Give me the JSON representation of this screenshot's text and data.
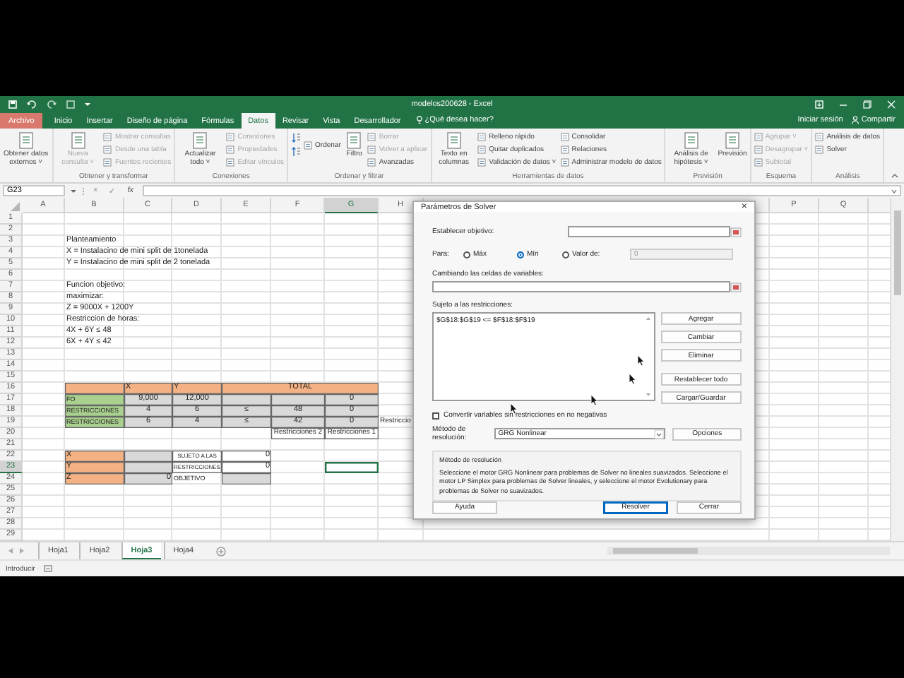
{
  "window": {
    "title": "modelos200628 - Excel"
  },
  "ribbon_tabs": [
    {
      "label": "Archivo",
      "kind": "file",
      "selected": false
    },
    {
      "label": "Inicio",
      "kind": "tab",
      "selected": false
    },
    {
      "label": "Insertar",
      "kind": "tab",
      "selected": false
    },
    {
      "label": "Diseño de página",
      "kind": "tab",
      "selected": false
    },
    {
      "label": "Fórmulas",
      "kind": "tab",
      "selected": false
    },
    {
      "label": "Datos",
      "kind": "tab",
      "selected": true
    },
    {
      "label": "Revisar",
      "kind": "tab",
      "selected": false
    },
    {
      "label": "Vista",
      "kind": "tab",
      "selected": false
    },
    {
      "label": "Desarrollador",
      "kind": "tab",
      "selected": false
    }
  ],
  "tell_me": "¿Qué desea hacer?",
  "account": {
    "sign_in": "Iniciar sesión",
    "share": "Compartir"
  },
  "ribbon": {
    "groups": [
      {
        "columns": [
          {
            "kind": "large",
            "label": "Obtener datos externos ˅",
            "disabled": false
          }
        ]
      },
      {
        "label": "Obtener y transformar",
        "columns": [
          {
            "kind": "large",
            "label": "Nueva consulta ˅",
            "disabled": true
          },
          {
            "kind": "small",
            "items": [
              {
                "label": "Mostrar consultas",
                "disabled": true
              },
              {
                "label": "Desde una tabla",
                "disabled": true
              },
              {
                "label": "Fuentes recientes",
                "disabled": true
              }
            ]
          }
        ]
      },
      {
        "label": "Conexiones",
        "columns": [
          {
            "kind": "large",
            "label": "Actualizar todo ˅",
            "disabled": false
          },
          {
            "kind": "small",
            "items": [
              {
                "label": "Conexiones",
                "disabled": true
              },
              {
                "label": "Propiedades",
                "disabled": true
              },
              {
                "label": "Editar vínculos",
                "disabled": true
              }
            ]
          }
        ]
      },
      {
        "label": "Ordenar y filtrar",
        "columns": [
          {
            "kind": "sort",
            "label": "Ordenar",
            "disabled": false
          },
          {
            "kind": "large",
            "label": "Filtro",
            "disabled": false
          },
          {
            "kind": "small",
            "items": [
              {
                "label": "Borrar",
                "disabled": true
              },
              {
                "label": "Volver a aplicar",
                "disabled": true
              },
              {
                "label": "Avanzadas",
                "disabled": false
              }
            ]
          }
        ]
      },
      {
        "label": "Herramientas de datos",
        "columns": [
          {
            "kind": "large",
            "label": "Texto en columnas",
            "disabled": false
          },
          {
            "kind": "small",
            "items": [
              {
                "label": "Relleno rápido",
                "disabled": false
              },
              {
                "label": "Quitar duplicados",
                "disabled": false
              },
              {
                "label": "Validación de datos ˅",
                "disabled": false
              }
            ]
          },
          {
            "kind": "small",
            "items": [
              {
                "label": "Consolidar",
                "disabled": false
              },
              {
                "label": "Relaciones",
                "disabled": false
              },
              {
                "label": "Administrar modelo de datos",
                "disabled": false
              }
            ]
          }
        ]
      },
      {
        "label": "Previsión",
        "columns": [
          {
            "kind": "large",
            "label": "Análisis de hipótesis ˅",
            "disabled": false
          },
          {
            "kind": "large",
            "label": "Previsión",
            "disabled": false
          }
        ]
      },
      {
        "label": "Esquema",
        "columns": [
          {
            "kind": "small",
            "items": [
              {
                "label": "Agrupar ˅",
                "disabled": true
              },
              {
                "label": "Desagrupar ˅",
                "disabled": true
              },
              {
                "label": "Subtotal",
                "disabled": true
              }
            ]
          }
        ]
      },
      {
        "label": "Análisis",
        "columns": [
          {
            "kind": "small",
            "items": [
              {
                "label": "Análisis de datos",
                "disabled": false
              },
              {
                "label": "Solver",
                "disabled": false
              }
            ]
          }
        ]
      }
    ]
  },
  "formula_bar": {
    "name_box": "G23",
    "buttons": [
      "×",
      "✓",
      "fx"
    ]
  },
  "sheet": {
    "columns": [
      "A",
      "B",
      "C",
      "D",
      "E",
      "F",
      "G",
      "H",
      "P",
      "Q"
    ],
    "rows": [
      {
        "number": "1"
      },
      {
        "number": "2"
      },
      {
        "number": "3",
        "cells": [
          null,
          {
            "kind": "text",
            "text": "Planteamiento",
            "selected": false
          }
        ]
      },
      {
        "number": "4",
        "cells": [
          null,
          {
            "kind": "text",
            "text": "X = Instalacino de mini split de 1tonelada",
            "selected": false
          }
        ]
      },
      {
        "number": "5",
        "cells": [
          null,
          {
            "kind": "text",
            "text": "Y = Instalacino de mini split de 2 tonelada",
            "selected": false
          }
        ]
      },
      {
        "number": "6"
      },
      {
        "number": "7",
        "cells": [
          null,
          {
            "kind": "text",
            "text": "Funcion objetivo:",
            "selected": false
          }
        ]
      },
      {
        "number": "8",
        "cells": [
          null,
          {
            "kind": "text",
            "text": "maximizar:",
            "selected": false
          }
        ]
      },
      {
        "number": "9",
        "cells": [
          null,
          {
            "kind": "text",
            "text": "Z = 9000X + 1200Y",
            "selected": false
          }
        ]
      },
      {
        "number": "10",
        "cells": [
          null,
          {
            "kind": "text",
            "text": "Restriccion de horas:",
            "selected": false
          }
        ]
      },
      {
        "number": "11",
        "cells": [
          null,
          {
            "kind": "text",
            "text": "4X + 6Y ≤ 48",
            "selected": false
          }
        ]
      },
      {
        "number": "12",
        "cells": [
          null,
          {
            "kind": "text",
            "text": "6X + 4Y ≤ 42",
            "selected": false
          }
        ]
      },
      {
        "number": "13"
      },
      {
        "number": "14"
      },
      {
        "number": "15"
      },
      {
        "number": "16",
        "cells": [
          null,
          {
            "kind": "head",
            "selected": false
          },
          {
            "kind": "head",
            "text": "X",
            "selected": false
          },
          {
            "kind": "head",
            "text": "Y",
            "selected": false
          },
          {
            "kind": "head_merged",
            "text": "TOTAL",
            "selected": false
          }
        ]
      },
      {
        "number": "17",
        "cells": [
          null,
          {
            "kind": "name",
            "text": "FO",
            "selected": false
          },
          {
            "kind": "num",
            "text": "9,000",
            "selected": false
          },
          {
            "kind": "num",
            "text": "12,000",
            "selected": false
          },
          {
            "kind": "num",
            "selected": false
          },
          {
            "kind": "num",
            "selected": false
          },
          {
            "kind": "num",
            "text": "0",
            "selected": false
          }
        ]
      },
      {
        "number": "18",
        "cells": [
          null,
          {
            "kind": "name",
            "text": "RESTRICCIONES",
            "selected": false
          },
          {
            "kind": "num",
            "text": "4",
            "selected": false
          },
          {
            "kind": "num",
            "text": "6",
            "selected": false
          },
          {
            "kind": "num",
            "text": "≤",
            "selected": false
          },
          {
            "kind": "num",
            "text": "48",
            "selected": false
          },
          {
            "kind": "num",
            "text": "0",
            "selected": false
          }
        ]
      },
      {
        "number": "19",
        "cells": [
          null,
          {
            "kind": "name",
            "text": "RESTRICCIONES",
            "selected": false
          },
          {
            "kind": "num",
            "text": "6",
            "selected": false
          },
          {
            "kind": "num",
            "text": "4",
            "selected": false
          },
          {
            "kind": "num",
            "text": "≤",
            "selected": false
          },
          {
            "kind": "num",
            "text": "42",
            "selected": false
          },
          {
            "kind": "num",
            "text": "0",
            "selected": false
          },
          {
            "kind": "text",
            "text": "Restriccio",
            "selected": false
          }
        ]
      },
      {
        "number": "20",
        "cells": [
          null,
          null,
          null,
          null,
          null,
          {
            "kind": "boxed",
            "text": "Restricciones 2",
            "selected": false
          },
          {
            "kind": "boxed",
            "text": "Restricciones 1",
            "selected": false
          }
        ]
      },
      {
        "number": "21"
      },
      {
        "number": "22",
        "cells": [
          null,
          {
            "kind": "head",
            "text": "X",
            "selected": false
          },
          {
            "kind": "num",
            "selected": false
          },
          {
            "kind": "note",
            "text": "SUJETO A LAS",
            "selected": false
          },
          {
            "kind": "boxed_right",
            "text": "0",
            "selected": false
          }
        ]
      },
      {
        "number": "23",
        "cells": [
          null,
          {
            "kind": "head",
            "text": "Y",
            "selected": false
          },
          {
            "kind": "num",
            "selected": false
          },
          {
            "kind": "note",
            "text": "RESTRICCIONES",
            "selected": false
          },
          {
            "kind": "boxed_right",
            "text": "0",
            "selected": false
          },
          null,
          {
            "kind": "text",
            "selected": true
          }
        ]
      },
      {
        "number": "24",
        "cells": [
          null,
          {
            "kind": "head",
            "text": "Z",
            "selected": false
          },
          {
            "kind": "num_right",
            "text": "0",
            "selected": false
          },
          {
            "kind": "note_left",
            "text": "OBJETIVO",
            "selected": false
          },
          {
            "kind": "num",
            "selected": false
          }
        ]
      },
      {
        "number": "25"
      },
      {
        "number": "26"
      },
      {
        "number": "27"
      },
      {
        "number": "28"
      },
      {
        "number": "29"
      }
    ]
  },
  "sheet_tabs": [
    {
      "label": "Hoja1",
      "selected": false
    },
    {
      "label": "Hoja2",
      "selected": false
    },
    {
      "label": "Hoja3",
      "selected": true
    },
    {
      "label": "Hoja4",
      "selected": false
    }
  ],
  "status_bar": {
    "mode": "Introducir"
  },
  "solver": {
    "title": "Parámetros de Solver",
    "close": "×",
    "objective": {
      "label": "Establecer objetivo:"
    },
    "to": {
      "label": "Para:",
      "options": [
        {
          "label": "Máx",
          "selected": false
        },
        {
          "label": "Mín",
          "selected": true
        },
        {
          "label": "Valor de:",
          "selected": false
        }
      ],
      "value_field": {
        "value": "0",
        "disabled": true
      }
    },
    "variables": {
      "label": "Cambiando las celdas de variables:"
    },
    "constraints": {
      "label": "Sujeto a las restricciones:",
      "items": [
        "$G$18:$G$19 <= $F$18:$F$19"
      ]
    },
    "side_buttons": [
      "Agregar",
      "Cambiar",
      "Eliminar",
      "Restablecer todo",
      "Cargar/Guardar"
    ],
    "nonneg": {
      "label": "Convertir variables sin restricciones en no negativas",
      "checked": false
    },
    "method": {
      "label": "Método de resolución:",
      "value": "GRG Nonlinear",
      "options_button": "Opciones"
    },
    "method_box": {
      "title": "Método de resolución",
      "text": "Seleccione el motor GRG Nonlinear para problemas de Solver no lineales suavizados. Seleccione el motor LP Simplex para problemas de Solver lineales, y seleccione el motor Evolutionary para problemas de Solver no suavizados."
    },
    "buttons": [
      {
        "label": "Ayuda",
        "default": false
      },
      {
        "label": "Resolver",
        "default": true
      },
      {
        "label": "Cerrar",
        "default": false
      }
    ]
  }
}
